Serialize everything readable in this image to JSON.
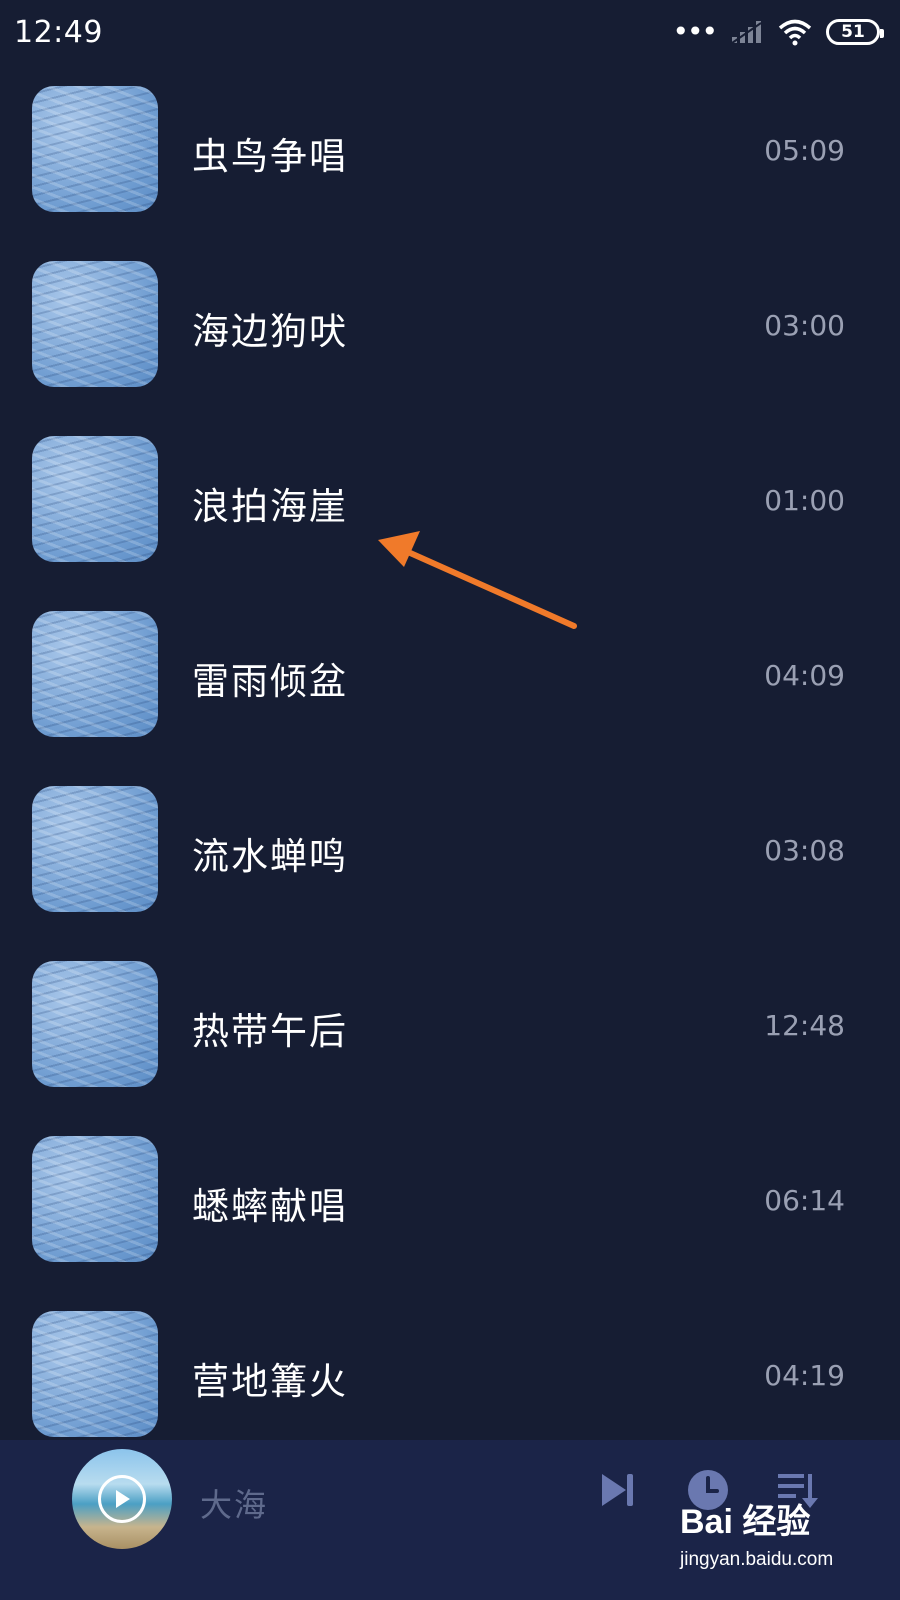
{
  "status_bar": {
    "time": "12:49",
    "battery": "51",
    "icons": [
      "more-dots-icon",
      "signal-icon",
      "wifi-icon",
      "battery-icon"
    ]
  },
  "tracks": [
    {
      "title": "虫鸟争唱",
      "duration": "05:09"
    },
    {
      "title": "海边狗吠",
      "duration": "03:00"
    },
    {
      "title": "浪拍海崖",
      "duration": "01:00"
    },
    {
      "title": "雷雨倾盆",
      "duration": "04:09"
    },
    {
      "title": "流水蝉鸣",
      "duration": "03:08"
    },
    {
      "title": "热带午后",
      "duration": "12:48"
    },
    {
      "title": "蟋蟀献唱",
      "duration": "06:14"
    },
    {
      "title": "营地篝火",
      "duration": "04:19"
    }
  ],
  "player": {
    "now_playing": "大海",
    "controls": [
      "play-icon",
      "skip-next-icon",
      "timer-icon",
      "playlist-icon"
    ]
  },
  "watermark": {
    "brand": "Bai 经验",
    "url": "jingyan.baidu.com"
  },
  "colors": {
    "background": "#161d33",
    "player_bar": "#1b2448",
    "annotation_arrow": "#f07a2a",
    "control_icons": "#6a78b0"
  }
}
